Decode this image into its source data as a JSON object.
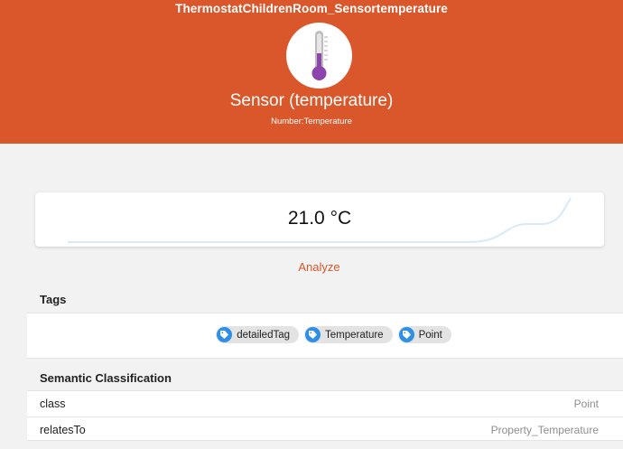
{
  "header": {
    "item_name": "ThermostatChildrenRoom_Sensortemperature",
    "label": "Sensor (temperature)",
    "type": "Number:Temperature",
    "icon": "thermometer-icon",
    "background_color": "#d9572a"
  },
  "state": {
    "value": "21.0 °C",
    "trend_color": "#d6eaf8"
  },
  "analyze_label": "Analyze",
  "tags": {
    "title": "Tags",
    "items": [
      {
        "label": "detailedTag",
        "icon": "tag-icon"
      },
      {
        "label": "Temperature",
        "icon": "tag-icon"
      },
      {
        "label": "Point",
        "icon": "tag-icon"
      }
    ]
  },
  "semantic": {
    "title": "Semantic Classification",
    "rows": [
      {
        "key": "class",
        "value": "Point"
      },
      {
        "key": "relatesTo",
        "value": "Property_Temperature"
      }
    ]
  }
}
